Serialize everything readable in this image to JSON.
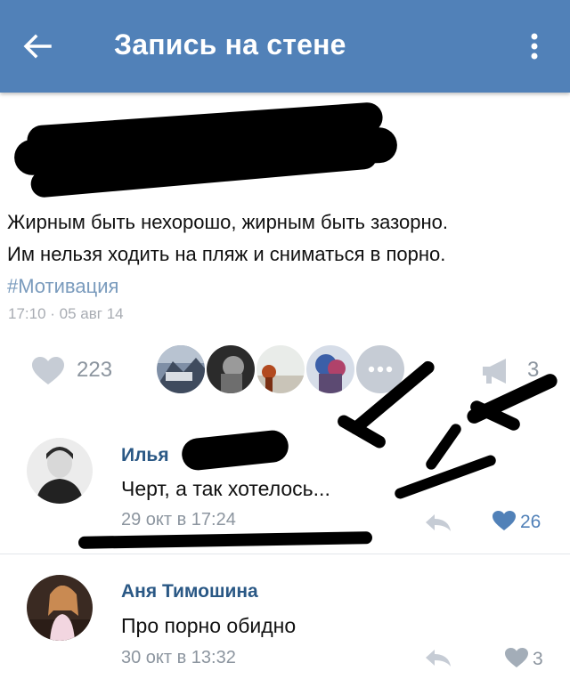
{
  "header": {
    "title": "Запись на стене",
    "back_icon": "arrow-left-icon",
    "menu_icon": "more-vertical-icon",
    "bg_color": "#5181b8"
  },
  "post": {
    "text_line1": "Жирным быть нехорошо, жирным быть зазорно.",
    "text_line2": "Им нельзя ходить на пляж и сниматься в порно.",
    "hashtag": "#Мотивация",
    "date": "17:10 · 05 авг 14",
    "likes": "223",
    "shares": "3"
  },
  "comments": [
    {
      "name": "Илья",
      "text": "Черт, а так хотелось...",
      "date": "29 окт в 17:24",
      "likes": "26",
      "liked": true
    },
    {
      "name": "Аня Тимошина",
      "text": "Про порно обидно",
      "date": "30 окт в 13:32",
      "likes": "3",
      "liked": false
    }
  ],
  "colors": {
    "accent": "#5181b8",
    "link": "#2a5885",
    "muted": "#8c959f",
    "liked": "#5181b8"
  }
}
